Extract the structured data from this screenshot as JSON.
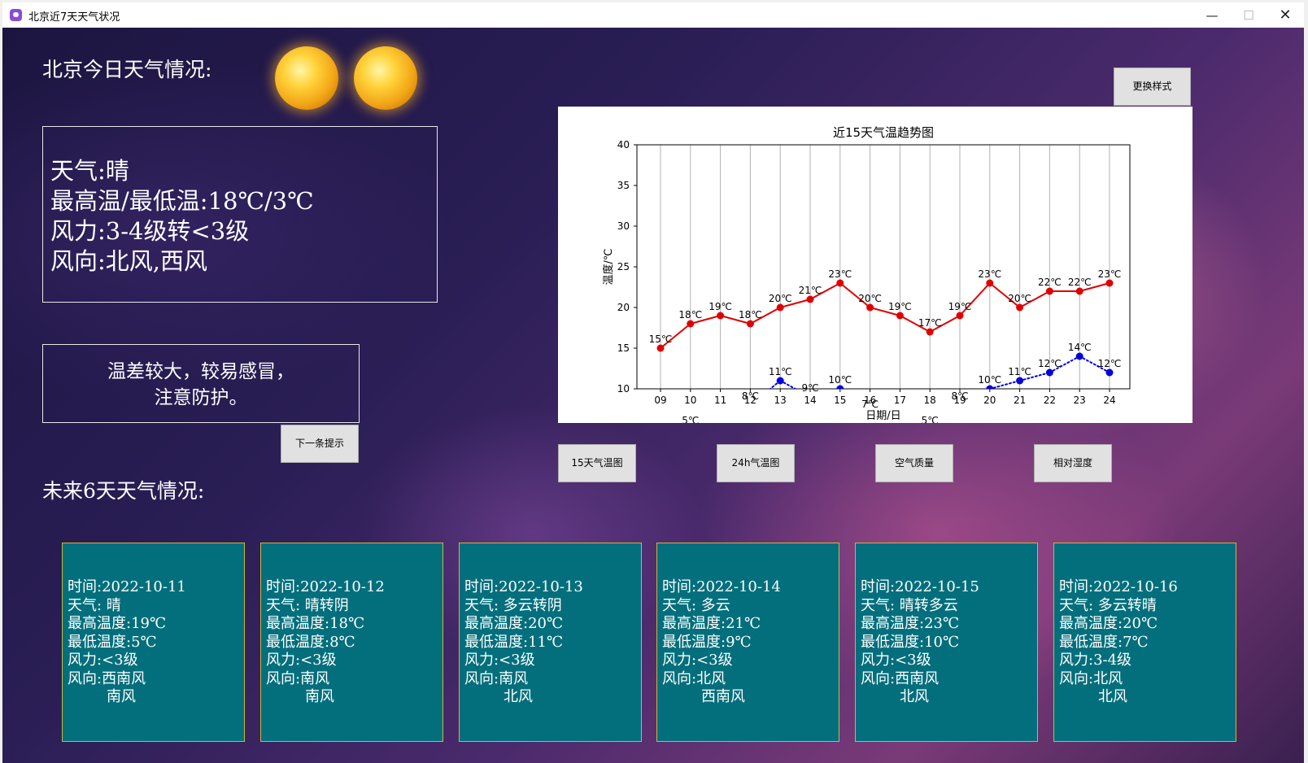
{
  "window": {
    "title": "北京近7天天气状况",
    "min_glyph": "—",
    "max_glyph": "☐",
    "close_glyph": "✕"
  },
  "today": {
    "heading": "北京今日天气情况:",
    "weather": "天气:晴",
    "temp_range": "最高温/最低温:18℃/3℃",
    "wind_force": "风力:3-4级转<3级",
    "wind_dir": "风向:北风,西风",
    "icons": [
      "sun-icon",
      "sun-icon"
    ]
  },
  "tip": {
    "line1": "温差较大，较易感冒，",
    "line2": "注意防护。",
    "next_label": "下一条提示"
  },
  "buttons": {
    "change_style": "更换样式",
    "temp15": "15天气温图",
    "temp24": "24h气温图",
    "air_quality": "空气质量",
    "humidity": "相对湿度"
  },
  "forecast": {
    "heading": "未来6天天气情况:",
    "days": [
      {
        "date": "时间:2022-10-11",
        "weather": "天气: 晴",
        "high": "最高温度:19℃",
        "low": "最低温度:5℃",
        "force": "风力:<3级",
        "dir1": "风向:西南风",
        "dir2": "南风"
      },
      {
        "date": "时间:2022-10-12",
        "weather": "天气: 晴转阴",
        "high": "最高温度:18℃",
        "low": "最低温度:8℃",
        "force": "风力:<3级",
        "dir1": "风向:南风",
        "dir2": "南风"
      },
      {
        "date": "时间:2022-10-13",
        "weather": "天气: 多云转阴",
        "high": "最高温度:20℃",
        "low": "最低温度:11℃",
        "force": "风力:<3级",
        "dir1": "风向:南风",
        "dir2": "北风"
      },
      {
        "date": "时间:2022-10-14",
        "weather": "天气: 多云",
        "high": "最高温度:21℃",
        "low": "最低温度:9℃",
        "force": "风力:<3级",
        "dir1": "风向:北风",
        "dir2": "西南风"
      },
      {
        "date": "时间:2022-10-15",
        "weather": "天气: 晴转多云",
        "high": "最高温度:23℃",
        "low": "最低温度:10℃",
        "force": "风力:<3级",
        "dir1": "风向:西南风",
        "dir2": "北风"
      },
      {
        "date": "时间:2022-10-16",
        "weather": "天气: 多云转晴",
        "high": "最高温度:20℃",
        "low": "最低温度:7℃",
        "force": "风力:3-4级",
        "dir1": "风向:北风",
        "dir2": "北风"
      }
    ]
  },
  "colors": {
    "high_series": "#e00000",
    "low_series": "#0000e0",
    "card_bg": "#046f7c",
    "card_border": "#c8b838"
  },
  "chart_data": {
    "type": "line",
    "title": "近15天气温趋势图",
    "xlabel": "日期/日",
    "ylabel": "温度/℃",
    "ylim": [
      10,
      40
    ],
    "yticks": [
      10,
      15,
      20,
      25,
      30,
      35,
      40
    ],
    "grid": "vertical",
    "categories": [
      "09",
      "10",
      "11",
      "12",
      "13",
      "14",
      "15",
      "16",
      "17",
      "18",
      "19",
      "20",
      "21",
      "22",
      "23",
      "24"
    ],
    "series": [
      {
        "style": "solid",
        "color": "#e00000",
        "values": [
          15,
          18,
          19,
          18,
          20,
          21,
          23,
          20,
          19,
          17,
          19,
          23,
          20,
          22,
          22,
          23
        ],
        "labels": [
          "15℃",
          "18℃",
          "19℃",
          "18℃",
          "20℃",
          "21℃",
          "23℃",
          "20℃",
          "19℃",
          "17℃",
          "19℃",
          "23℃",
          "20℃",
          "22℃",
          "22℃",
          "23℃"
        ]
      },
      {
        "style": "dotted",
        "color": "#0000e0",
        "values": [
          null,
          5,
          null,
          8,
          11,
          9,
          10,
          7,
          null,
          5,
          8,
          10,
          11,
          12,
          14,
          12
        ],
        "labels": [
          null,
          "5℃",
          null,
          "8℃",
          "11℃",
          "9℃",
          "10℃",
          "7℃",
          null,
          "5℃",
          "8℃",
          "10℃",
          "11℃",
          "12℃",
          "14℃",
          "12℃"
        ]
      }
    ]
  }
}
